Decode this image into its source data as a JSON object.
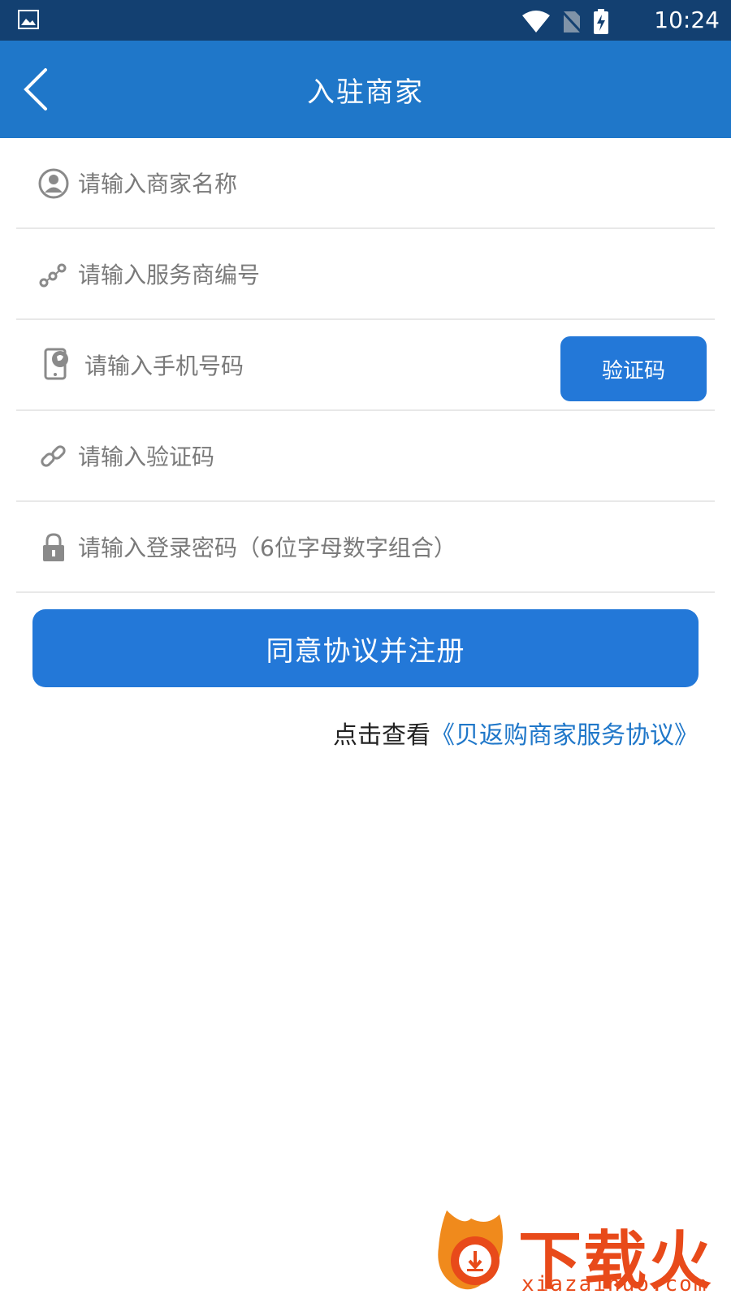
{
  "statusbar": {
    "time": "10:24",
    "icons": [
      "image-icon",
      "wifi-icon",
      "no-sim-icon",
      "battery-charging-icon"
    ]
  },
  "appbar": {
    "title": "入驻商家",
    "back_icon": "chevron-left-icon"
  },
  "form": {
    "merchant_name": {
      "placeholder": "请输入商家名称",
      "icon": "user-circle-icon"
    },
    "provider_id": {
      "placeholder": "请输入服务商编号",
      "icon": "network-icon"
    },
    "phone": {
      "placeholder": "请输入手机号码",
      "icon": "phone-icon",
      "code_button": "验证码"
    },
    "verify_code": {
      "placeholder": "请输入验证码",
      "icon": "link-icon"
    },
    "password": {
      "placeholder": "请输入登录密码（6位字母数字组合）",
      "icon": "lock-icon"
    }
  },
  "register_button": "同意协议并注册",
  "agreement": {
    "prefix": "点击查看",
    "link": "《贝返购商家服务协议》"
  },
  "watermark": {
    "cn": "下载火",
    "en": "xiazaihuo.com"
  },
  "colors": {
    "statusbar": "#134071",
    "appbar": "#1f77c9",
    "button": "#2378d8",
    "watermark": "#e84a1a"
  }
}
